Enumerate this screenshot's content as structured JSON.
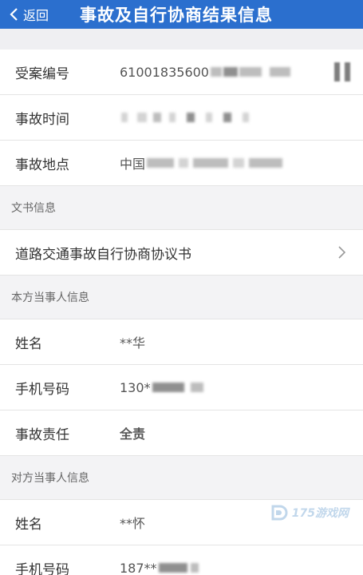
{
  "header": {
    "back_label": "返回",
    "title": "事故及自行协商结果信息"
  },
  "case": {
    "number_label": "受案编号",
    "number_value": "61001835600",
    "time_label": "事故时间",
    "place_label": "事故地点",
    "place_value": "中国"
  },
  "documents": {
    "section_title": "文书信息",
    "item_label": "道路交通事故自行协商协议书"
  },
  "own_party": {
    "section_title": "本方当事人信息",
    "name_label": "姓名",
    "name_value": "**华",
    "phone_label": "手机号码",
    "phone_value": "130*",
    "liability_label": "事故责任",
    "liability_value": "全责"
  },
  "other_party": {
    "section_title": "对方当事人信息",
    "name_label": "姓名",
    "name_value": "**怀",
    "phone_label": "手机号码",
    "phone_value": "187**"
  },
  "watermark": {
    "text": "175游戏网"
  },
  "colors": {
    "header_bg": "#2b6fce",
    "liability": "#d6232c"
  },
  "icons": {
    "back": "chevron-left-icon",
    "row_arrow": "chevron-right-icon"
  }
}
